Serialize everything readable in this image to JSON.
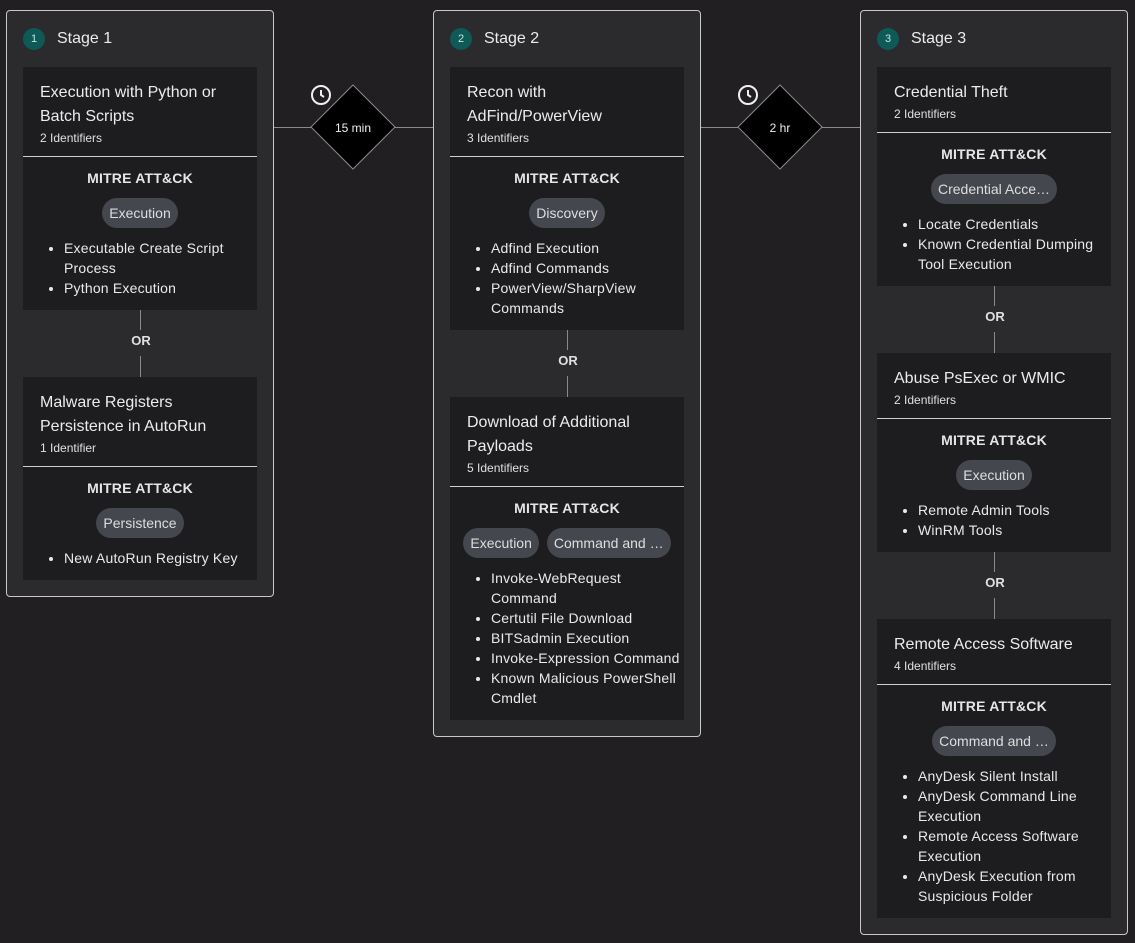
{
  "stages": [
    {
      "num": "1",
      "title": "Stage 1",
      "cards": [
        {
          "title": "Execution with Python or Batch Scripts",
          "identifiers": "2 Identifiers",
          "mitre": "MITRE ATT&CK",
          "tactics": [
            "Execution"
          ],
          "items": [
            "Executable Create Script Process",
            "Python Execution"
          ]
        },
        {
          "title": "Malware Registers Persistence in AutoRun",
          "identifiers": "1 Identifier",
          "mitre": "MITRE ATT&CK",
          "tactics": [
            "Persistence"
          ],
          "items": [
            "New AutoRun Registry Key"
          ]
        }
      ],
      "or": [
        "OR"
      ]
    },
    {
      "num": "2",
      "title": "Stage 2",
      "cards": [
        {
          "title": "Recon with AdFind/PowerView",
          "identifiers": "3 Identifiers",
          "mitre": "MITRE ATT&CK",
          "tactics": [
            "Discovery"
          ],
          "items": [
            "Adfind Execution",
            "Adfind Commands",
            "PowerView/SharpView Commands"
          ]
        },
        {
          "title": "Download of Additional Payloads",
          "identifiers": "5 Identifiers",
          "mitre": "MITRE ATT&CK",
          "tactics": [
            "Execution",
            "Command and …"
          ],
          "items": [
            "Invoke-WebRequest Command",
            "Certutil File Download",
            "BITSadmin Execution",
            "Invoke-Expression Command",
            "Known Malicious PowerShell Cmdlet"
          ]
        }
      ],
      "or": [
        "OR"
      ]
    },
    {
      "num": "3",
      "title": "Stage 3",
      "cards": [
        {
          "title": "Credential Theft",
          "identifiers": "2 Identifiers",
          "mitre": "MITRE ATT&CK",
          "tactics": [
            "Credential Acce…"
          ],
          "items": [
            "Locate Credentials",
            "Known Credential Dumping Tool Execution"
          ]
        },
        {
          "title": "Abuse PsExec or WMIC",
          "identifiers": "2 Identifiers",
          "mitre": "MITRE ATT&CK",
          "tactics": [
            "Execution"
          ],
          "items": [
            "Remote Admin Tools",
            "WinRM Tools"
          ]
        },
        {
          "title": "Remote Access Software",
          "identifiers": "4 Identifiers",
          "mitre": "MITRE ATT&CK",
          "tactics": [
            "Command and …"
          ],
          "items": [
            "AnyDesk Silent Install",
            "AnyDesk Command Line Execution",
            "Remote Access Software Execution",
            "AnyDesk Execution from Suspicious Folder"
          ]
        }
      ],
      "or": [
        "OR",
        "OR"
      ]
    }
  ],
  "connectors": [
    {
      "label": "15 min",
      "icon": "clock-icon"
    },
    {
      "label": "2 hr",
      "icon": "clock-icon"
    }
  ],
  "colors": {
    "background": "#211f22",
    "stage_bg": "#2b2a2d",
    "card_bg": "#1d1c1f",
    "badge": "#0f5956",
    "pill": "#45474e"
  }
}
